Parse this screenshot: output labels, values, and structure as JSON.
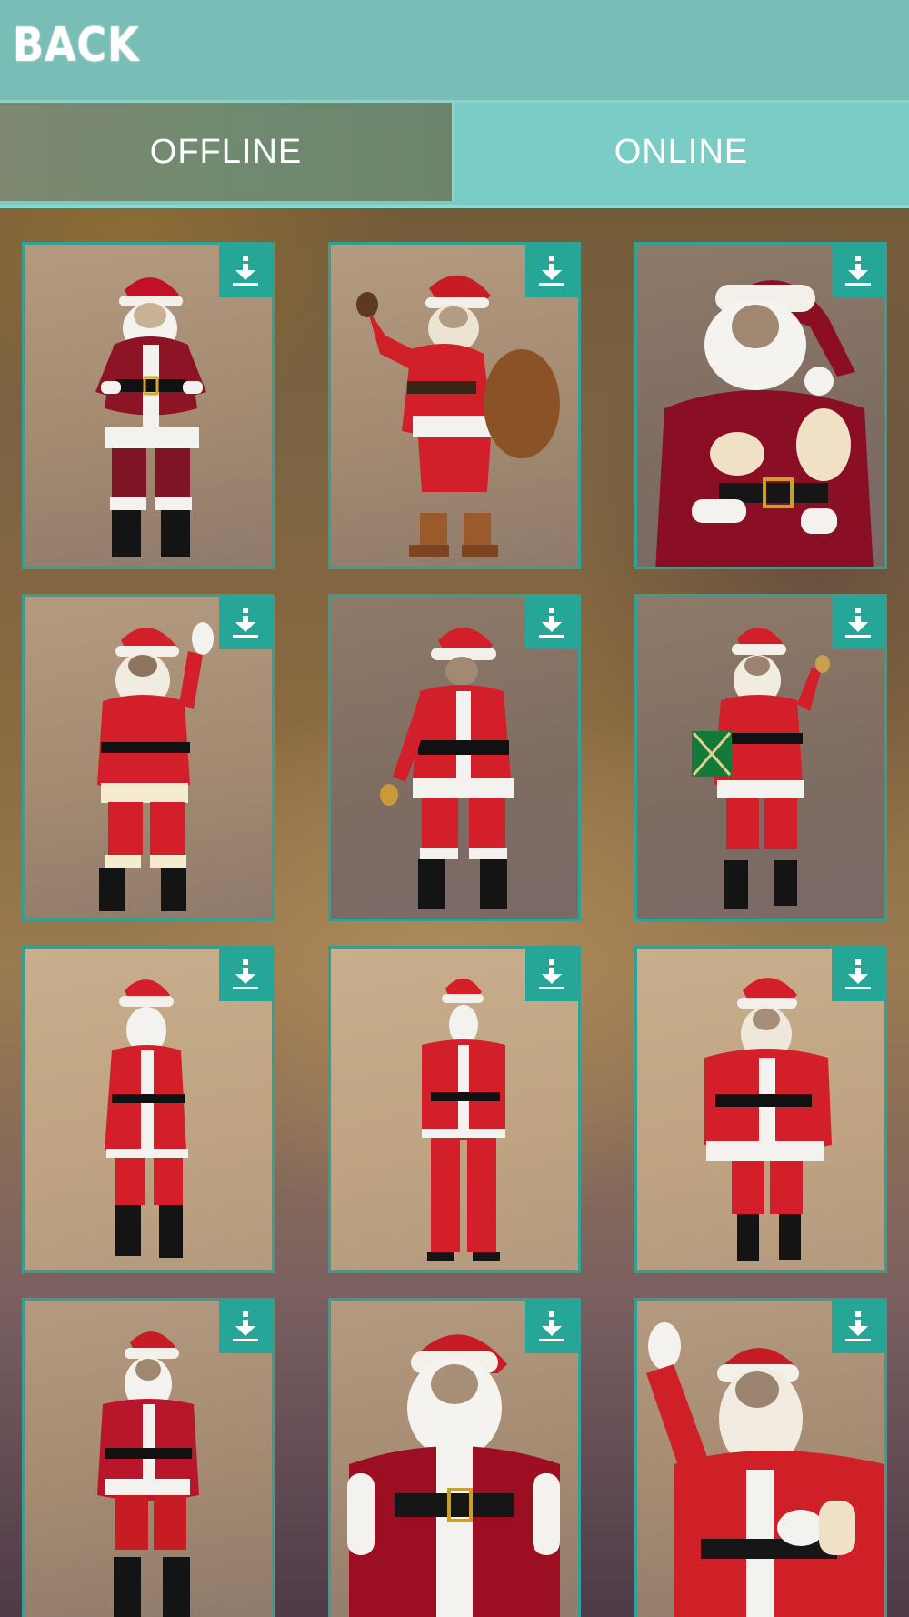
{
  "header": {
    "back_label": "BACK"
  },
  "tabs": {
    "offline_label": "OFFLINE",
    "online_label": "ONLINE",
    "selected": "OFFLINE"
  },
  "icons": {
    "download": "download-icon"
  },
  "colors": {
    "accent": "#26a697",
    "topbar": "#78bdb6",
    "tab_bar": "#79cbc4",
    "card_border": "#2ea295"
  },
  "items_count_visible": 12
}
